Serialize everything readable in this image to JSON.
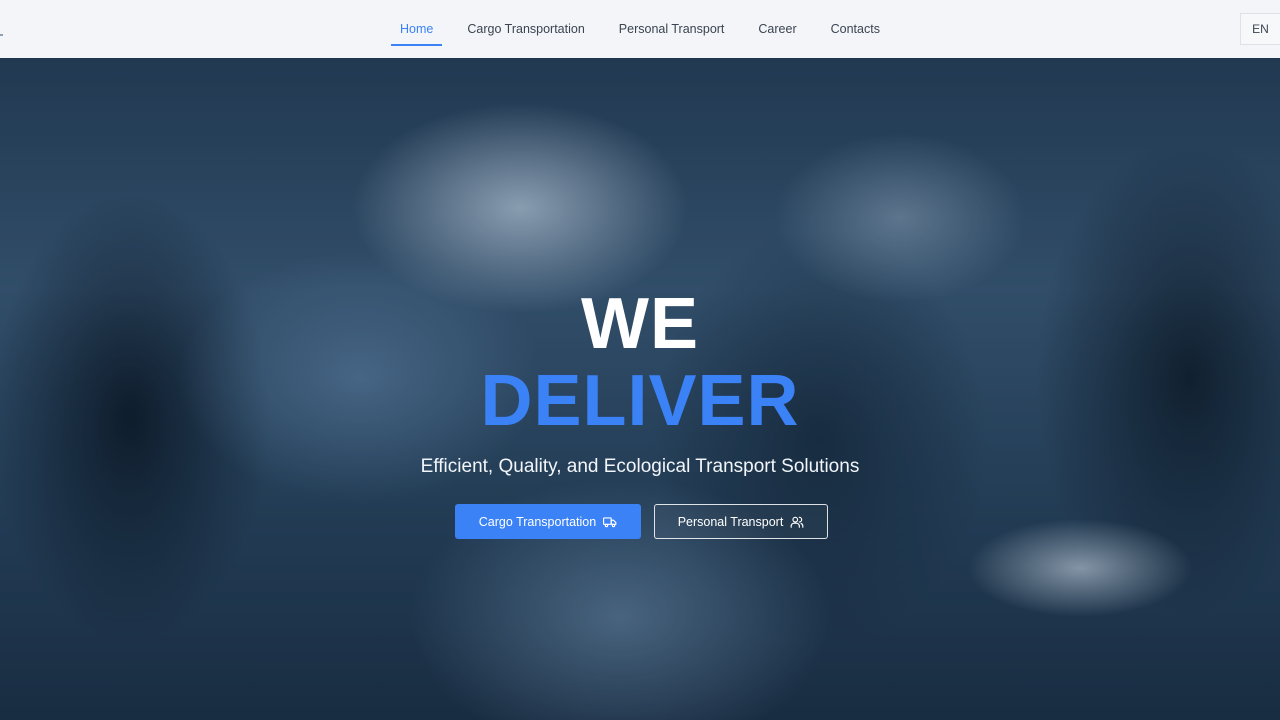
{
  "nav": {
    "items": [
      {
        "label": "Home",
        "active": true
      },
      {
        "label": "Cargo Transportation",
        "active": false
      },
      {
        "label": "Personal Transport",
        "active": false
      },
      {
        "label": "Career",
        "active": false
      },
      {
        "label": "Contacts",
        "active": false
      }
    ],
    "language": "EN"
  },
  "hero": {
    "title_line1": "WE",
    "title_line2": "DELIVER",
    "subtitle": "Efficient, Quality, and Ecological Transport Solutions",
    "primary_button": {
      "label": "Cargo Transportation",
      "icon": "truck-icon"
    },
    "secondary_button": {
      "label": "Personal Transport",
      "icon": "users-icon"
    }
  },
  "colors": {
    "accent": "#3b82f6",
    "nav_background": "#f3f5f8",
    "nav_text": "#3b4451",
    "hero_text": "#ffffff"
  }
}
